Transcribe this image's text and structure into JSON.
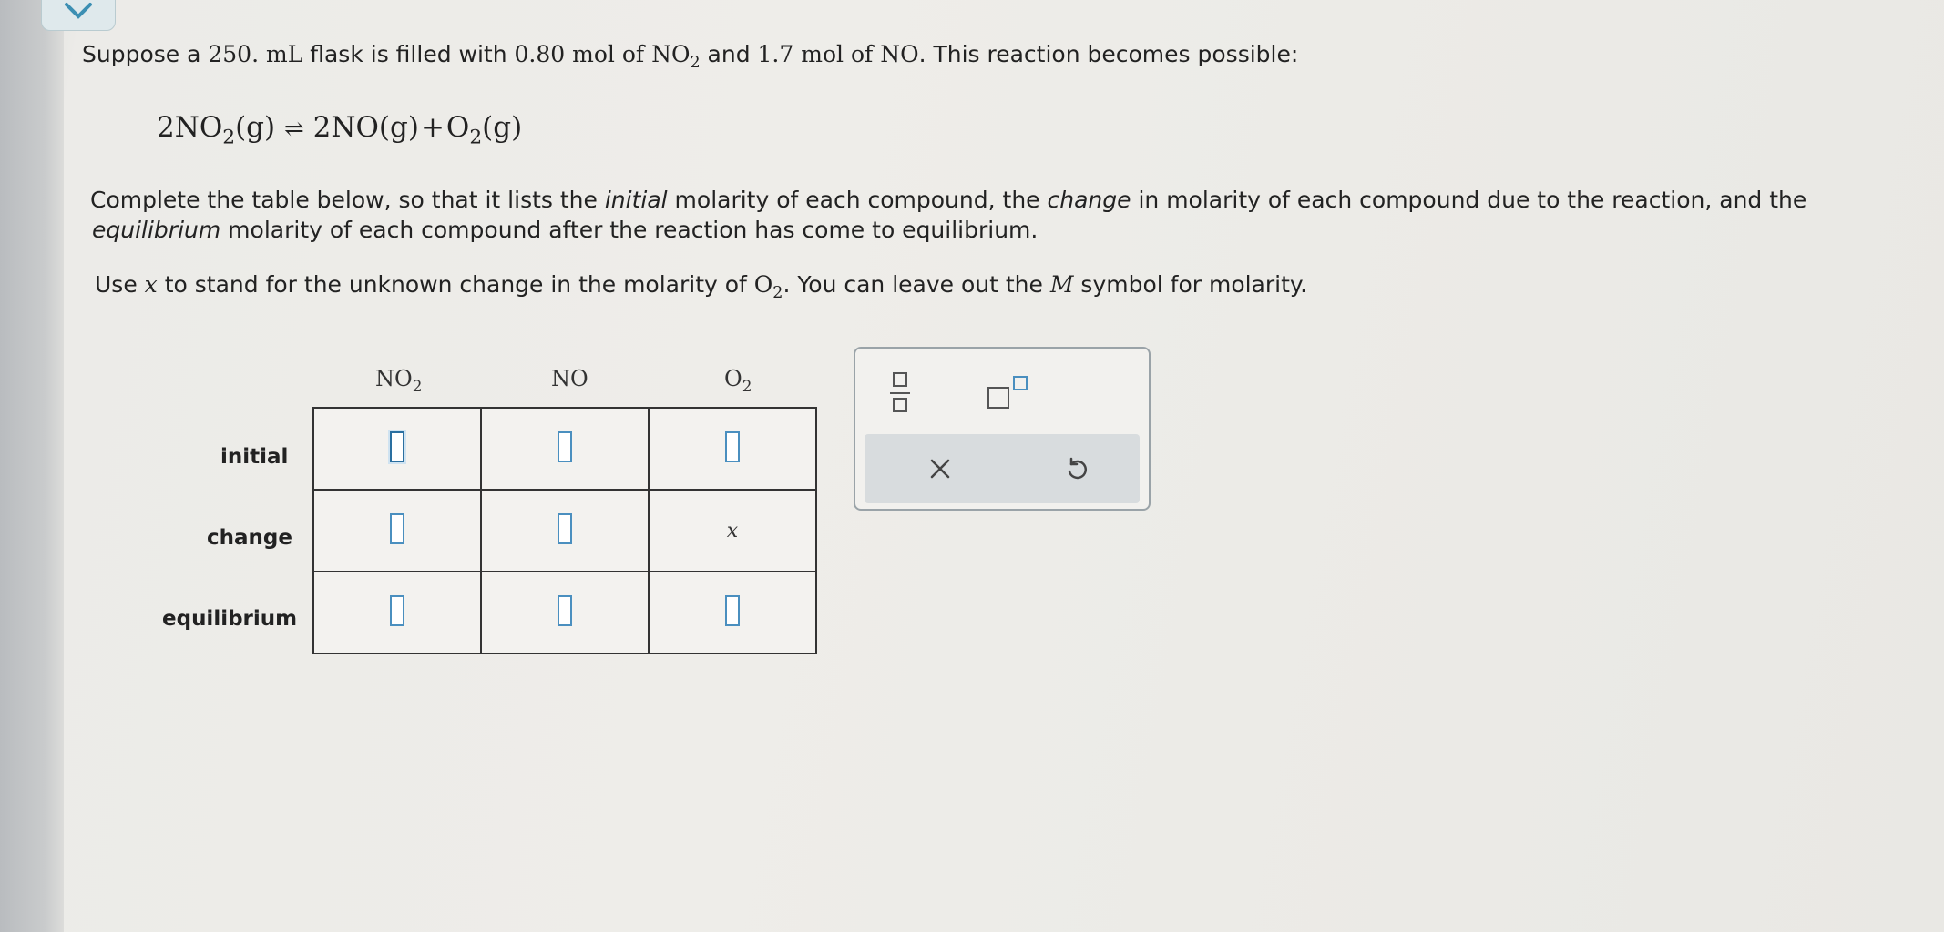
{
  "intro": {
    "t1": "Suppose a ",
    "volume": "250. mL",
    "t2": " flask is filled with ",
    "no2_amount": "0.80 mol",
    "t3": " of ",
    "no2": "NO",
    "t4": " and ",
    "no_amount": "1.7 mol",
    "t5": " of ",
    "no": "NO",
    "t6": ". This reaction becomes possible:"
  },
  "equation": {
    "left": "2NO",
    "left_state": "(g)",
    "arrow": "⇌",
    "right1": "2NO(g)",
    "plus": "+",
    "right2": "O",
    "right2_state": "(g)"
  },
  "instructions": {
    "p1_a": "Complete the table below, so that it lists the ",
    "p1_initial": "initial",
    "p1_b": " molarity of each compound, the ",
    "p1_change": "change",
    "p1_c": " in molarity of each compound due to the reaction, and the",
    "p2_equilibrium": "equilibrium",
    "p2_b": " molarity of each compound after the reaction has come to equilibrium.",
    "p3_a": "Use ",
    "p3_x": "x",
    "p3_b": " to stand for the unknown change in the molarity of ",
    "p3_o2": "O",
    "p3_c": ". You can leave out the ",
    "p3_M": "M",
    "p3_d": " symbol for molarity."
  },
  "table": {
    "columns": [
      "NO2",
      "NO",
      "O2"
    ],
    "rows": [
      "initial",
      "change",
      "equilibrium"
    ],
    "change_o2_value": "x"
  },
  "toolbox": {
    "fraction_tool": "fraction-icon",
    "superscript_tool": "superscript-icon",
    "clear_button": "close-icon",
    "undo_button": "undo-icon"
  }
}
